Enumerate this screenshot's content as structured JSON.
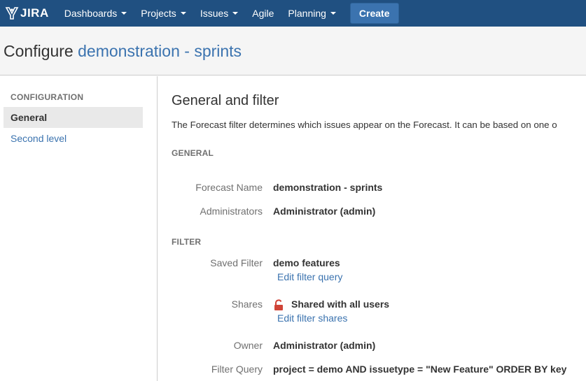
{
  "nav": {
    "logo_text": "JIRA",
    "items": [
      {
        "label": "Dashboards",
        "dropdown": true
      },
      {
        "label": "Projects",
        "dropdown": true
      },
      {
        "label": "Issues",
        "dropdown": true
      },
      {
        "label": "Agile",
        "dropdown": false
      },
      {
        "label": "Planning",
        "dropdown": true
      }
    ],
    "create_label": "Create"
  },
  "header": {
    "title_prefix": "Configure",
    "title_project": "demonstration - sprints"
  },
  "sidebar": {
    "heading": "CONFIGURATION",
    "items": [
      {
        "label": "General",
        "active": true
      },
      {
        "label": "Second level",
        "active": false
      }
    ]
  },
  "main": {
    "title": "General and filter",
    "description": "The Forecast filter determines which issues appear on the Forecast. It can be based on one o",
    "general_heading": "GENERAL",
    "forecast_name_label": "Forecast Name",
    "forecast_name_value": "demonstration - sprints",
    "administrators_label": "Administrators",
    "administrators_value": "Administrator (admin)",
    "filter_heading": "FILTER",
    "saved_filter_label": "Saved Filter",
    "saved_filter_value": "demo features",
    "edit_filter_query": "Edit filter query",
    "shares_label": "Shares",
    "shares_value": "Shared with all users",
    "edit_filter_shares": "Edit filter shares",
    "owner_label": "Owner",
    "owner_value": "Administrator (admin)",
    "filter_query_label": "Filter Query",
    "filter_query_value": "project = demo AND issuetype = \"New Feature\" ORDER BY key"
  },
  "colors": {
    "nav_bg": "#205081",
    "link": "#3b73af",
    "lock": "#d04437"
  },
  "icons": [
    "jira-logo-icon",
    "caret-down-icon",
    "lock-icon"
  ]
}
